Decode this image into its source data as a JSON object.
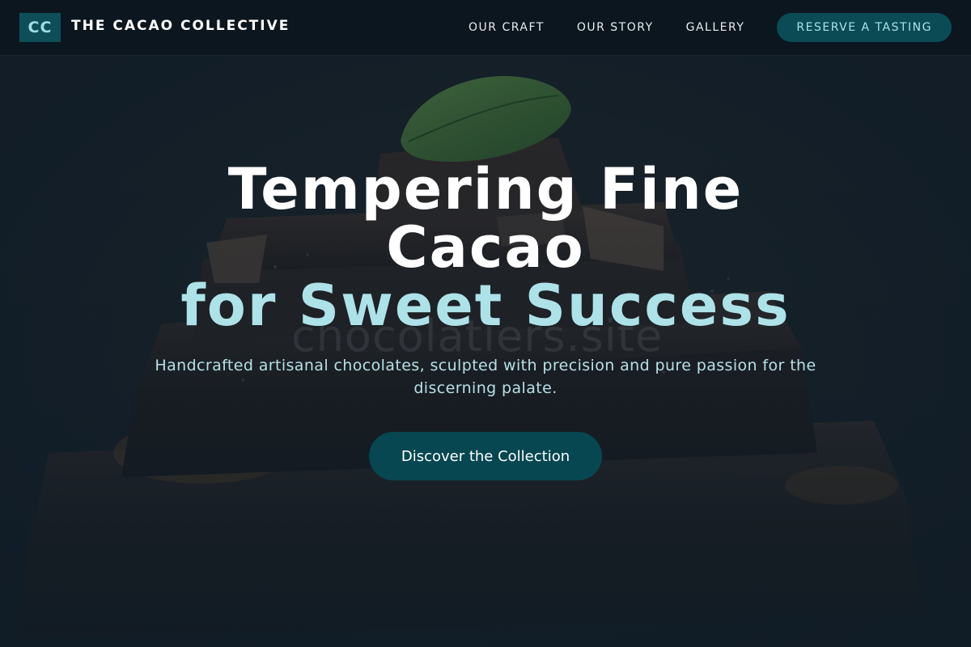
{
  "header": {
    "logo_text": "CC",
    "brand_name": "THE CACAO COLLECTIVE",
    "nav": [
      {
        "label": "OUR CRAFT"
      },
      {
        "label": "OUR STORY"
      },
      {
        "label": "GALLERY"
      }
    ],
    "cta_label": "RESERVE A TASTING"
  },
  "hero": {
    "title_line1": "Tempering Fine Cacao",
    "title_line2": "for Sweet Success",
    "subtitle": "Handcrafted artisanal chocolates, sculpted with precision and pure passion for the discerning palate.",
    "cta_label": "Discover the Collection",
    "background_image": "stack-of-dark-chocolate-bars-with-mint-leaf",
    "watermark": "chocolatiers.site"
  },
  "colors": {
    "background": "#15222c",
    "header_bg": "#0b161f",
    "accent": "#0b4b55",
    "accent_text": "#ade2e8",
    "logo_bg": "#0e4e58"
  }
}
